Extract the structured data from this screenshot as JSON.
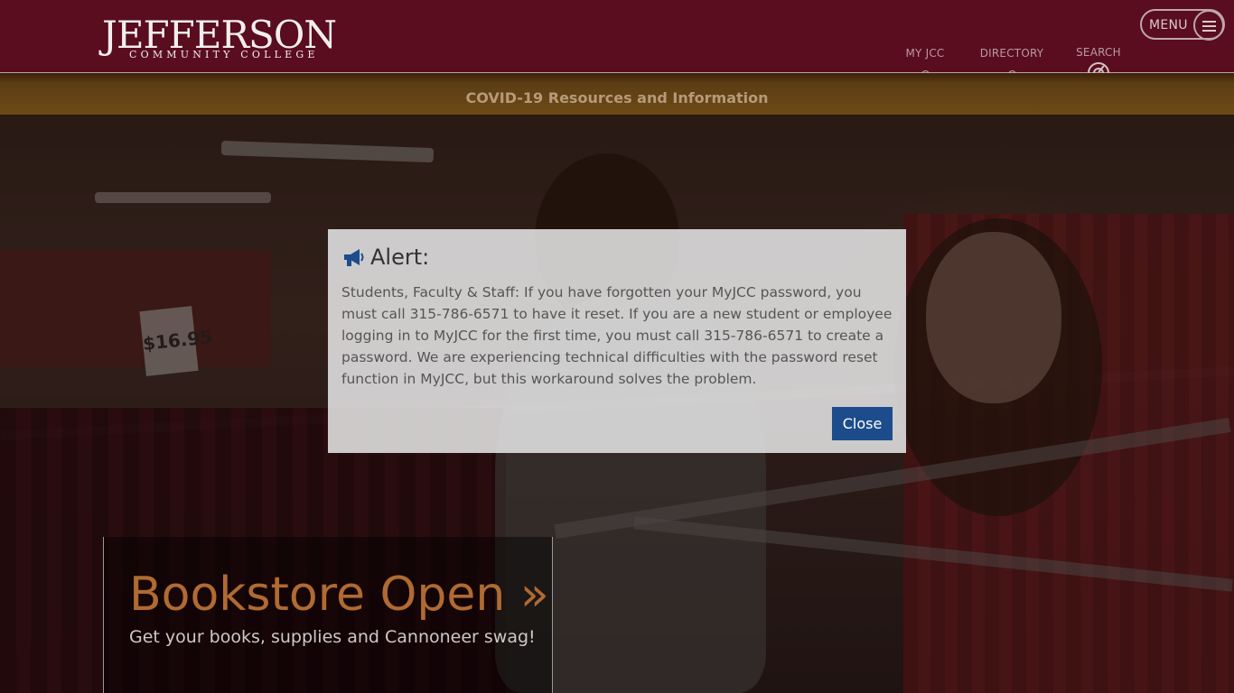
{
  "header": {
    "logo_main": "JEFFERSON",
    "logo_sub": "COMMUNITY COLLEGE",
    "nav": {
      "myjcc": "MY JCC",
      "directory": "DIRECTORY",
      "search": "SEARCH"
    },
    "menu_label": "MENU"
  },
  "banner": {
    "covid_link": "COVID-19 Resources and Information"
  },
  "hero": {
    "price_tag": "$16.95",
    "title": "Bookstore Open »",
    "subtitle": "Get your books, supplies and Cannoneer swag!"
  },
  "alert": {
    "icon": "megaphone-icon",
    "title": "Alert:",
    "body": "Students, Faculty & Staff: If you have forgotten your MyJCC password, you must call 315-786-6571 to have it reset. If you are a new student or employee logging in to MyJCC for the first time, you must call 315-786-6571 to create a password. We are experiencing technical difficulties with the password reset function in MyJCC, but this workaround solves the problem.",
    "close_label": "Close"
  },
  "colors": {
    "header_bg": "#5a0d1f",
    "banner_bg": "#6d4a16",
    "accent_orange": "#b06a32",
    "button_blue": "#1d4c8c"
  }
}
